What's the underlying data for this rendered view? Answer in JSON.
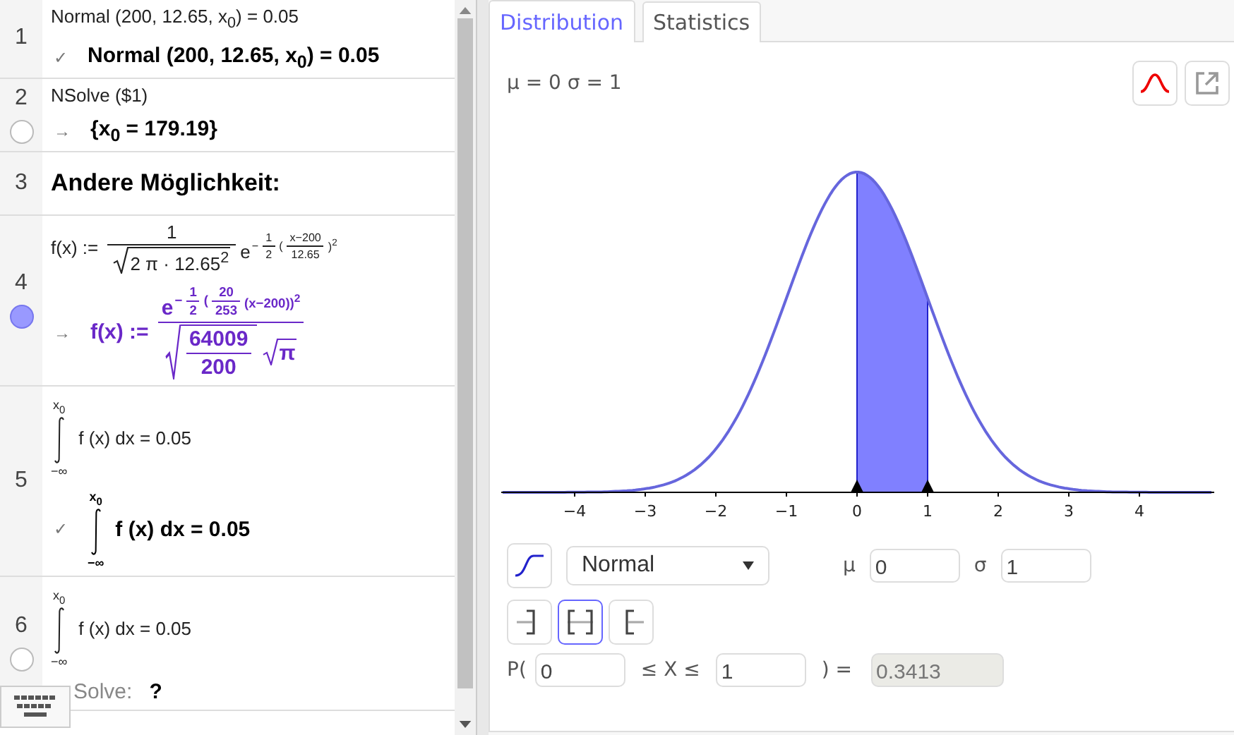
{
  "cas": {
    "rows": [
      {
        "number": "1",
        "input": "Normal (200, 12.65, x$_{0}$) = 0.05",
        "marker": "✓",
        "output": "Normal (200, 12.65, x$_{0}$) = 0.05"
      },
      {
        "number": "2",
        "visible": false,
        "input": "NSolve ($1)",
        "marker": "→",
        "output": "{x$_{0}$ = 179.19}"
      },
      {
        "number": "3",
        "kind": "text",
        "text": "Andere Möglichkeit:"
      },
      {
        "number": "4",
        "visible": true,
        "input": {
          "kind": "seq",
          "items": [
            "f(x) := ",
            {
              "kind": "frac",
              "num": "1",
              "den": {
                "kind": "sqrt",
                "body": "2 π · 12.65$^{2}$"
              }
            },
            {
              "kind": "sup",
              "base": "e",
              "exp": {
                "kind": "seq",
                "items": [
                  "−",
                  {
                    "kind": "frac",
                    "num": "1",
                    "den": "2"
                  },
                  "(",
                  {
                    "kind": "frac",
                    "num": "x−200",
                    "den": "12.65"
                  },
                  ")$^{2}$"
                ]
              }
            }
          ]
        },
        "marker": "→",
        "color": "#6a28c8",
        "output": {
          "kind": "seq",
          "items": [
            "f(x) := ",
            {
              "kind": "frac",
              "num": {
                "kind": "sup",
                "base": "e",
                "exp": {
                  "kind": "seq",
                  "items": [
                    "−",
                    {
                      "kind": "frac",
                      "num": "1",
                      "den": "2"
                    },
                    "(",
                    {
                      "kind": "frac",
                      "num": "20",
                      "den": "253"
                    },
                    "(x−200))$^{2}$"
                  ]
                }
              },
              "den": {
                "kind": "seq",
                "items": [
                  {
                    "kind": "sqrt",
                    "body": {
                      "kind": "frac",
                      "num": "64009",
                      "den": "200"
                    }
                  },
                  {
                    "kind": "sqrt",
                    "body": "π"
                  }
                ]
              }
            }
          ]
        }
      },
      {
        "number": "5",
        "input": {
          "kind": "int",
          "upper": "x$_{0}$",
          "lower": "−∞",
          "body": "f (x) dx = 0.05"
        },
        "marker": "✓",
        "output": {
          "kind": "int",
          "upper": "x$_{0}$",
          "lower": "−∞",
          "body": "f (x) dx = 0.05"
        }
      },
      {
        "number": "6",
        "visible": false,
        "input": {
          "kind": "int",
          "upper": "x$_{0}$",
          "lower": "−∞",
          "body": "f (x) dx = 0.05"
        },
        "output_label": "Solve:",
        "output": "?"
      }
    ]
  },
  "tabs": [
    {
      "label": "Distribution",
      "selected": true
    },
    {
      "label": "Statistics",
      "selected": false
    }
  ],
  "distribution": {
    "parameters_text": "μ = 0 σ = 1",
    "x_ticks": [
      "−4",
      "−3",
      "−2",
      "−1",
      "0",
      "1",
      "2",
      "3",
      "4"
    ],
    "cumulative": false,
    "type": "Normal",
    "parameters": [
      {
        "symbol": "μ",
        "value": "0"
      },
      {
        "symbol": "σ",
        "value": "1"
      }
    ],
    "interval_modes": [
      {
        "kind": "left",
        "selected": false
      },
      {
        "kind": "two-sided",
        "selected": true
      },
      {
        "kind": "right",
        "selected": false
      }
    ],
    "probability": {
      "prefix": "P(",
      "lower": "0",
      "middle": "≤ X ≤",
      "upper": "1",
      "suffix": ") =",
      "result": "0.3413",
      "result_disabled": true
    }
  }
}
